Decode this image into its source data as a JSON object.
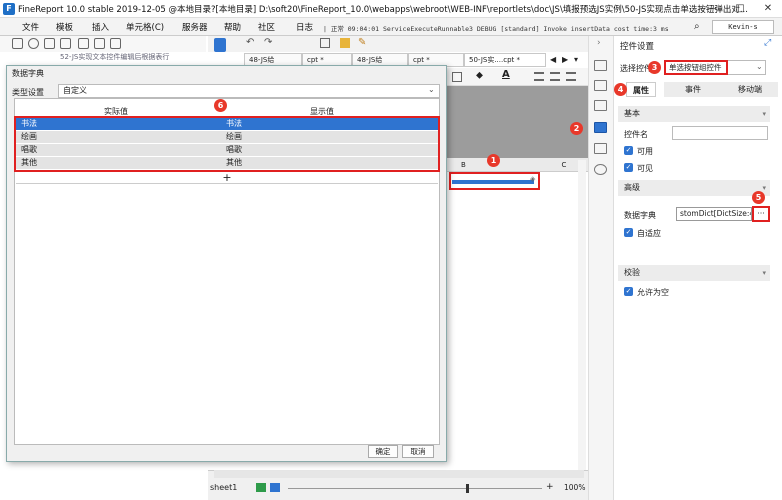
{
  "window": {
    "title": "FineReport 10.0 stable 2019-12-05 @本地目录?[本地目录]    D:\\soft20\\FineReport_10.0\\webapps\\webroot\\WEB-INF\\reportlets\\doc\\JS\\填报预选JS实例\\50-JS实现点击单选按钮弹出对...",
    "minimize": "—",
    "maximize": "□",
    "close": "✕"
  },
  "menu": {
    "items": [
      "文件",
      "模板",
      "插入",
      "单元格(C)",
      "服务器",
      "帮助",
      "社区"
    ],
    "log_label": "日志",
    "log_text": "| 正常 09:04:01 ServiceExecuteRunnable3 DEBUG [standard] Invoke insertData cost time:3 ms",
    "user": "Kevin-s"
  },
  "left_tree": {
    "row_text": "52-JS实现文本控件编辑后根据表行"
  },
  "tabs": [
    {
      "label": "48-JS给",
      "active": false
    },
    {
      "label": "cpt *",
      "active": false
    },
    {
      "label": "48-JS给",
      "active": false
    },
    {
      "label": "cpt *",
      "active": false
    },
    {
      "label": "50-JS实....cpt *",
      "active": true
    }
  ],
  "grid": {
    "col_b": "B",
    "col_c": "C"
  },
  "sheet": {
    "name": "sheet1",
    "zoom": "100%"
  },
  "panel": {
    "title": "控件设置",
    "select_label": "选择控件",
    "select_value": "单选按钮组控件",
    "tab_attr": "属性",
    "tab_event": "事件",
    "tab_mobile": "移动端",
    "section_basic": "基本",
    "name_label": "控件名",
    "name_value": "",
    "check_enabled": "可用",
    "check_visible": "可见",
    "section_advanced": "高级",
    "dict_label": "数据字典",
    "dict_value": "stomDict[DictSize:4]",
    "dict_button": "···",
    "check_adaptive": "自适应",
    "section_validate": "校验",
    "check_allow_empty": "允许为空"
  },
  "dialog": {
    "title": "数据字典",
    "type_label": "类型设置",
    "type_value": "自定义",
    "col_actual": "实际值",
    "col_display": "显示值",
    "rows": [
      {
        "actual": "书法",
        "display": "书法"
      },
      {
        "actual": "绘画",
        "display": "绘画"
      },
      {
        "actual": "唱歌",
        "display": "唱歌"
      },
      {
        "actual": "其他",
        "display": "其他"
      }
    ],
    "add": "+",
    "ok": "确定",
    "cancel": "取消"
  },
  "badges": [
    "1",
    "2",
    "3",
    "4",
    "5",
    "6"
  ],
  "colors": {
    "accent": "#2f74d0",
    "highlight": "#e02020"
  }
}
